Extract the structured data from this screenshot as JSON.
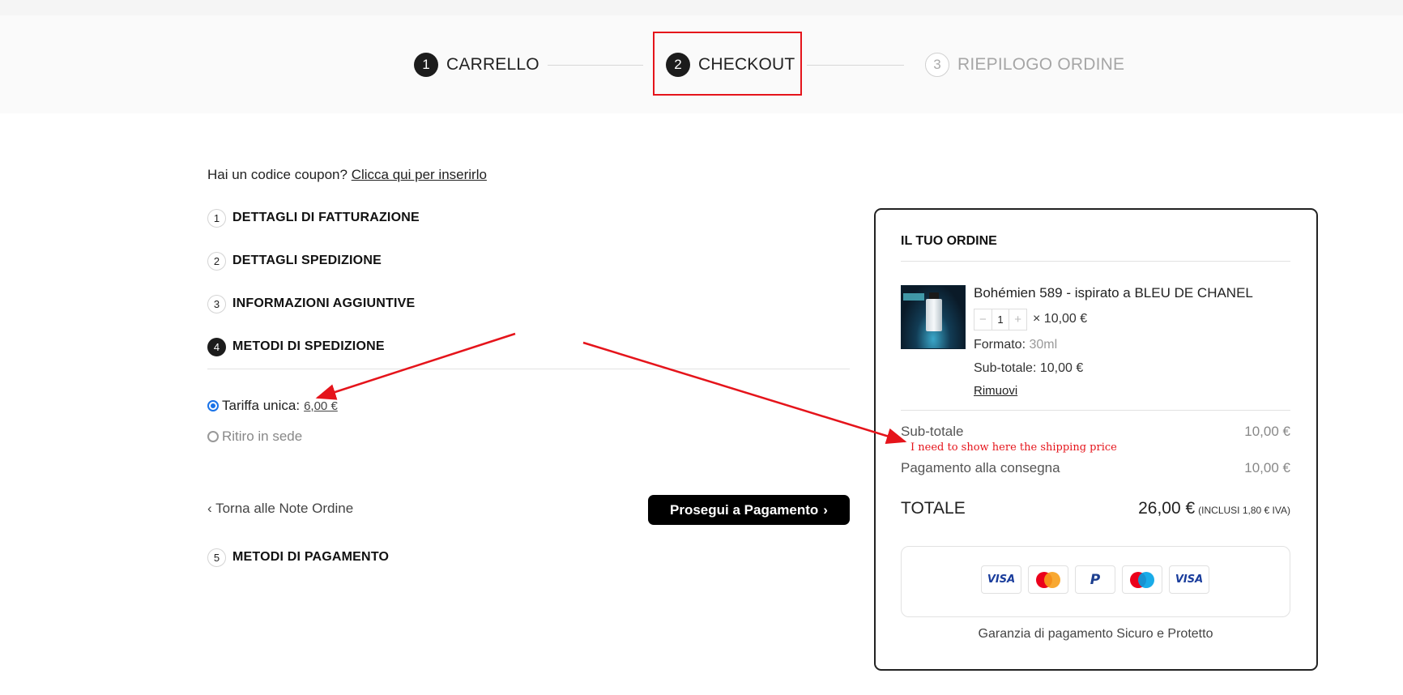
{
  "stepper": {
    "steps": [
      {
        "num": "1",
        "label": "CARRELLO"
      },
      {
        "num": "2",
        "label": "CHECKOUT"
      },
      {
        "num": "3",
        "label": "RIEPILOGO ORDINE"
      }
    ]
  },
  "coupon": {
    "prompt": "Hai un codice coupon?",
    "link": "Clicca qui per inserirlo"
  },
  "sections": [
    {
      "num": "1",
      "title": "DETTAGLI DI FATTURAZIONE"
    },
    {
      "num": "2",
      "title": "DETTAGLI SPEDIZIONE"
    },
    {
      "num": "3",
      "title": "INFORMAZIONI AGGIUNTIVE"
    },
    {
      "num": "4",
      "title": "METODI DI SPEDIZIONE"
    },
    {
      "num": "5",
      "title": "METODI DI PAGAMENTO"
    }
  ],
  "shipping_options": [
    {
      "label": "Tariffa unica:",
      "price": "6,00 €",
      "checked": true
    },
    {
      "label": "Ritiro in sede",
      "checked": false
    }
  ],
  "nav": {
    "back_label": "Torna alle Note Ordine",
    "next_label": "Prosegui a Pagamento"
  },
  "order": {
    "title": "IL TUO ORDINE",
    "product": {
      "name": "Bohémien 589 - ispirato a BLEU DE CHANEL",
      "qty": "1",
      "unit_price": "× 10,00 €",
      "format_label": "Formato:",
      "format_value": "30ml",
      "subtotal_label": "Sub-totale:",
      "subtotal_value": "10,00 €",
      "remove_label": "Rimuovi"
    },
    "subtotal_label": "Sub-totale",
    "subtotal_value": "10,00 €",
    "cod_label": "Pagamento alla consegna",
    "cod_value": "10,00 €",
    "total_label": "TOTALE",
    "total_value": "26,00 €",
    "total_tax": "(INCLUSI 1,80 € IVA)",
    "payment_icons": [
      "visa-icon",
      "mastercard-icon",
      "paypal-icon",
      "maestro-icon",
      "visa-icon"
    ],
    "secure_note": "Garanzia di pagamento Sicuro e Protetto"
  },
  "annotation": {
    "text": "I need to show here the shipping price",
    "color": "#e5141b"
  },
  "colors": {
    "accent": "#1a73e8",
    "annotation": "#e5141b",
    "button": "#000000"
  }
}
